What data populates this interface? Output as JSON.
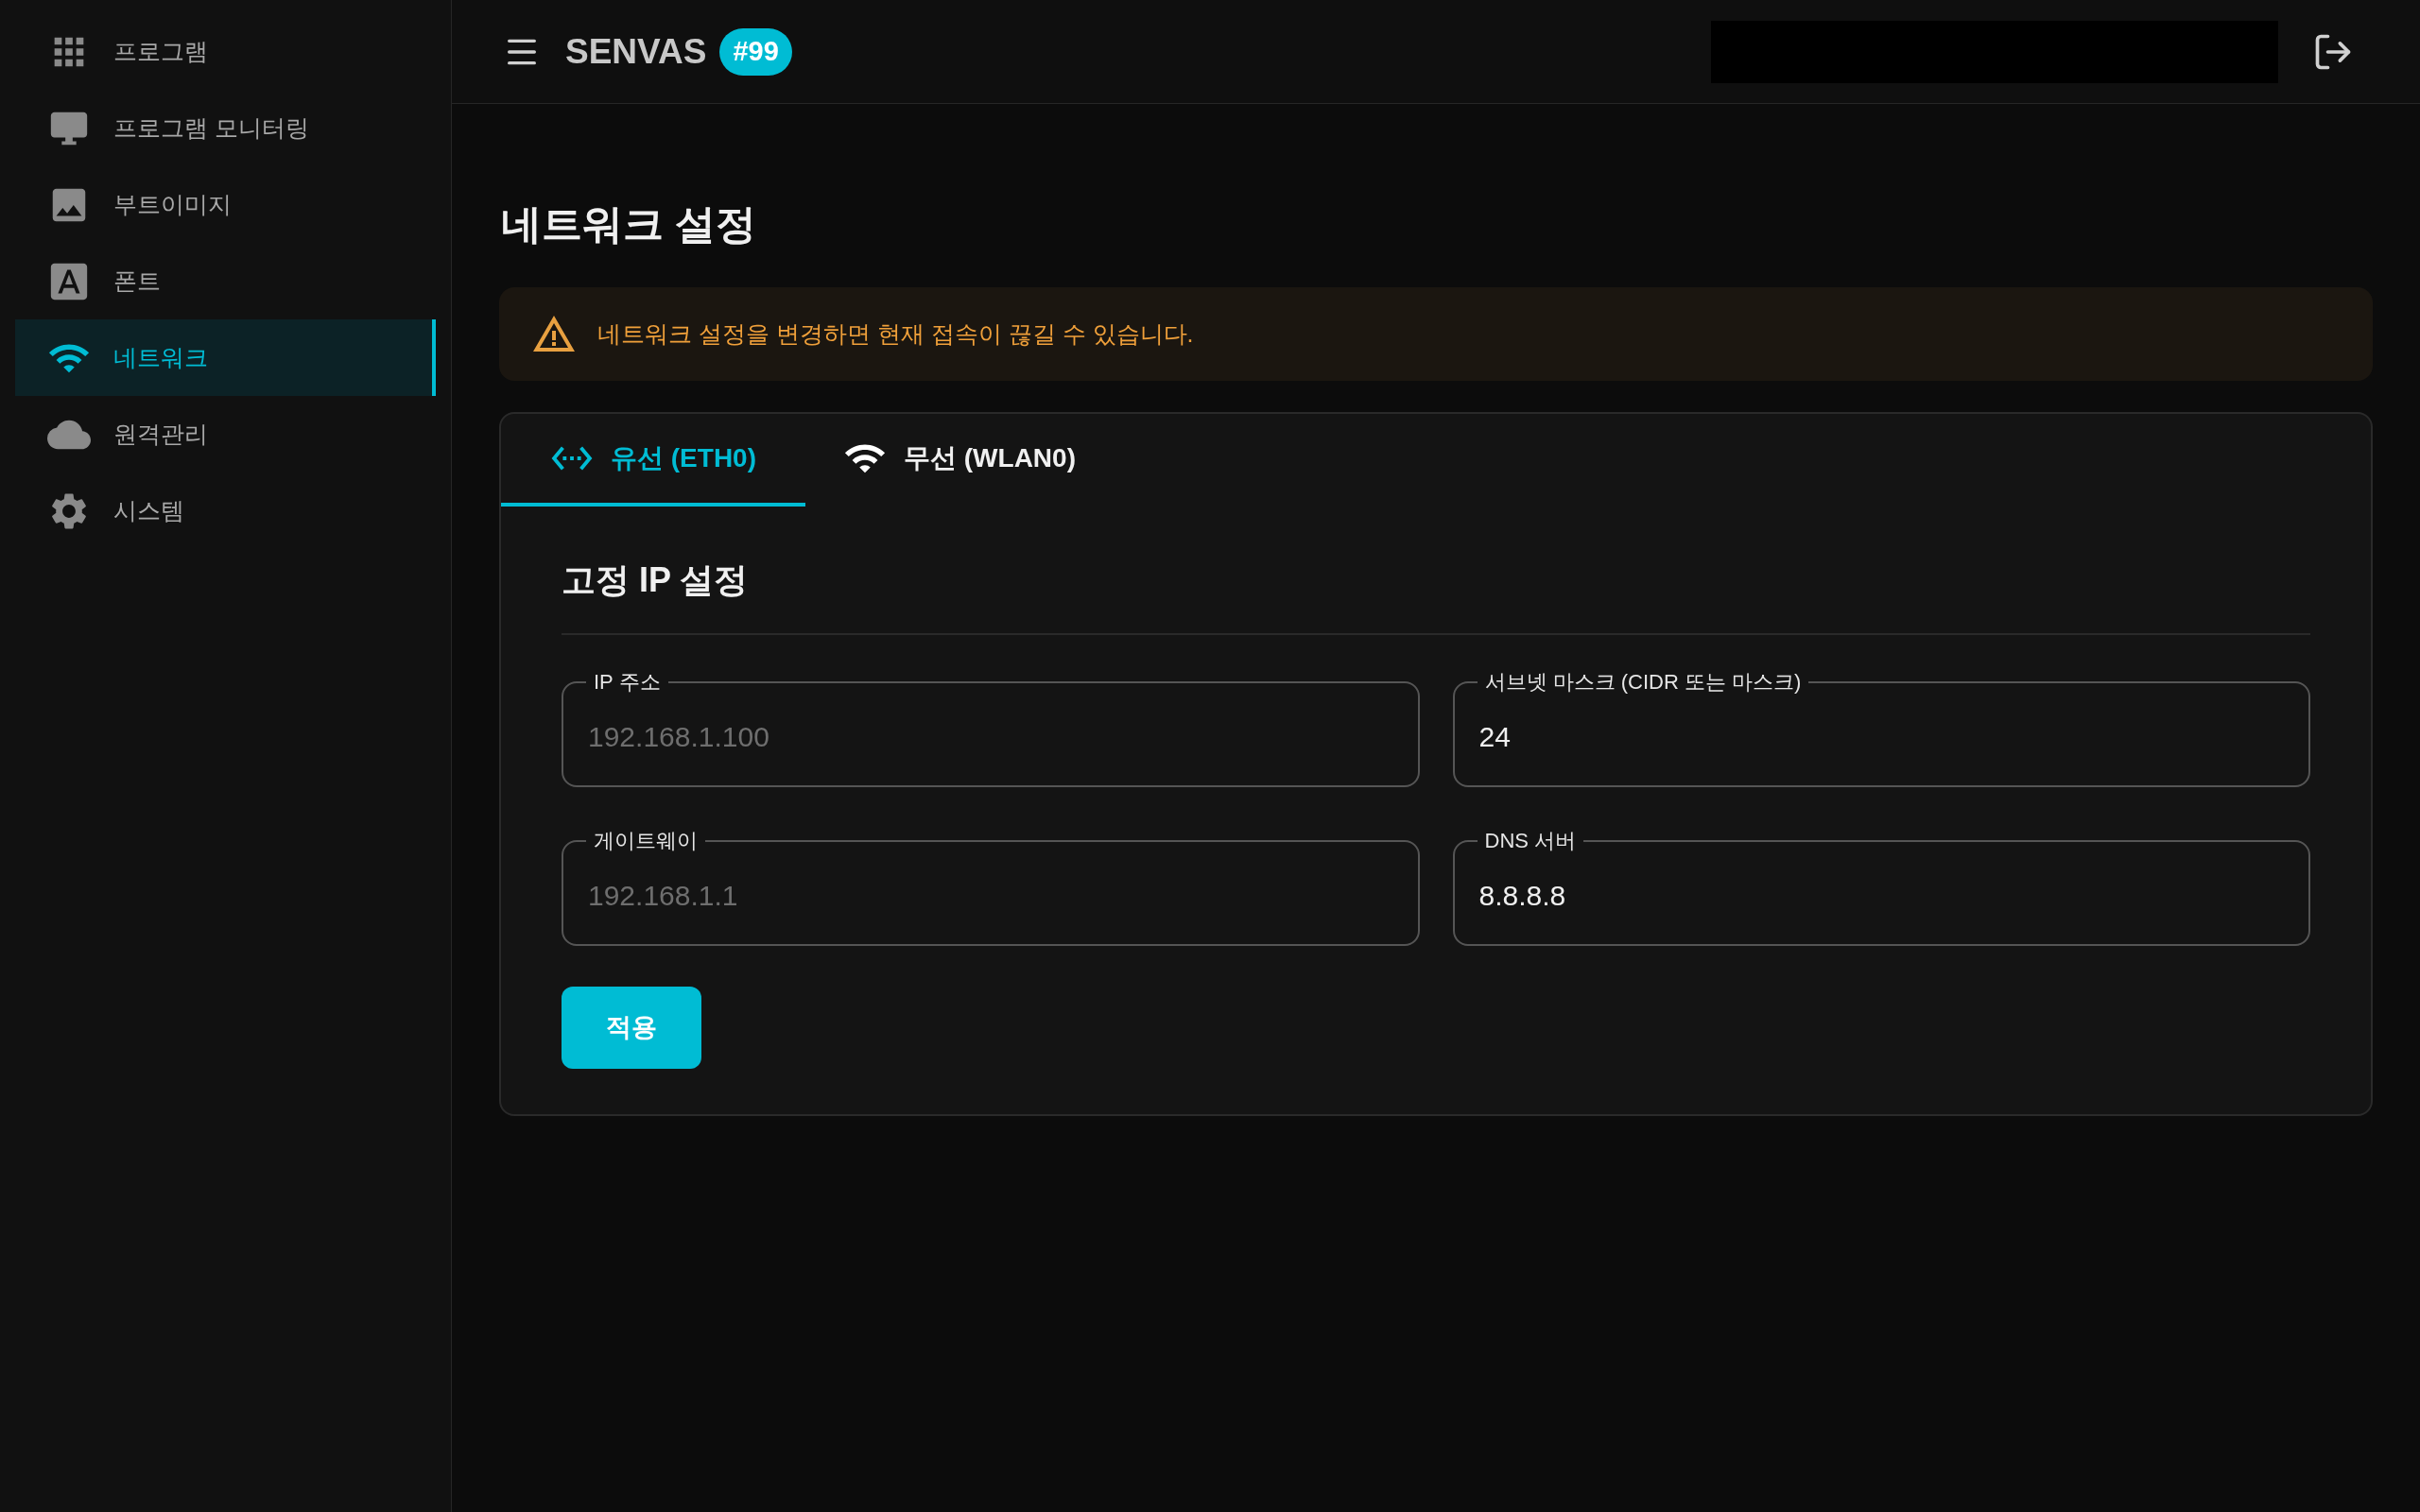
{
  "sidebar": {
    "items": [
      {
        "label": "프로그램",
        "selected": false
      },
      {
        "label": "프로그램 모니터링",
        "selected": false
      },
      {
        "label": "부트이미지",
        "selected": false
      },
      {
        "label": "폰트",
        "selected": false
      },
      {
        "label": "네트워크",
        "selected": true
      },
      {
        "label": "원격관리",
        "selected": false
      },
      {
        "label": "시스템",
        "selected": false
      }
    ]
  },
  "header": {
    "brand": "SENVAS",
    "badge": "#99"
  },
  "page": {
    "title": "네트워크 설정",
    "warning": "네트워크 설정을 변경하면 현재 접속이 끊길 수 있습니다."
  },
  "tabs": [
    {
      "label": "유선 (ETH0)",
      "selected": true
    },
    {
      "label": "무선 (WLAN0)",
      "selected": false
    }
  ],
  "section": {
    "title": "고정 IP 설정",
    "fields": [
      {
        "label": "IP 주소",
        "placeholder": "192.168.1.100"
      },
      {
        "label": "서브넷 마스크 (CIDR 또는 마스크)",
        "value": "24"
      },
      {
        "label": "게이트웨이",
        "placeholder": "192.168.1.1"
      },
      {
        "label": "DNS 서버",
        "value": "8.8.8.8"
      }
    ],
    "button": "적용"
  }
}
